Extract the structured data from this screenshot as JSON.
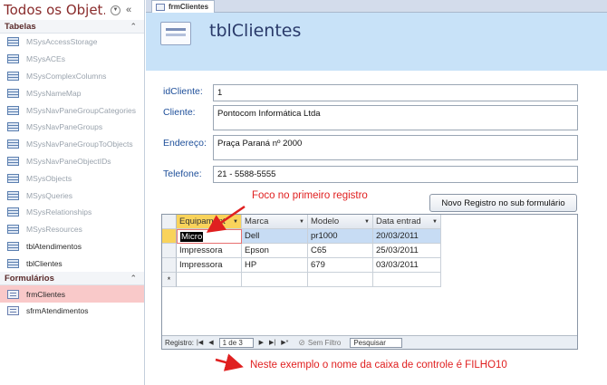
{
  "nav": {
    "title": "Todos os Objet...",
    "groups": [
      {
        "label": "Tabelas",
        "items": [
          {
            "label": "MSysAccessStorage",
            "icon": "table-icon",
            "dim": true
          },
          {
            "label": "MSysACEs",
            "icon": "table-icon",
            "dim": true
          },
          {
            "label": "MSysComplexColumns",
            "icon": "table-icon",
            "dim": true
          },
          {
            "label": "MSysNameMap",
            "icon": "table-icon",
            "dim": true
          },
          {
            "label": "MSysNavPaneGroupCategories",
            "icon": "table-icon",
            "dim": true
          },
          {
            "label": "MSysNavPaneGroups",
            "icon": "table-icon",
            "dim": true
          },
          {
            "label": "MSysNavPaneGroupToObjects",
            "icon": "table-icon",
            "dim": true
          },
          {
            "label": "MSysNavPaneObjectIDs",
            "icon": "table-icon",
            "dim": true
          },
          {
            "label": "MSysObjects",
            "icon": "table-icon",
            "dim": true
          },
          {
            "label": "MSysQueries",
            "icon": "table-icon",
            "dim": true
          },
          {
            "label": "MSysRelationships",
            "icon": "table-icon",
            "dim": true
          },
          {
            "label": "MSysResources",
            "icon": "table-icon",
            "dim": true
          },
          {
            "label": "tblAtendimentos",
            "icon": "table-icon",
            "dim": false
          },
          {
            "label": "tblClientes",
            "icon": "table-icon",
            "dim": false
          }
        ]
      },
      {
        "label": "Formulários",
        "items": [
          {
            "label": "frmClientes",
            "icon": "form-icon",
            "dim": false,
            "selected": true
          },
          {
            "label": "sfrmAtendimentos",
            "icon": "form-icon",
            "dim": false
          }
        ]
      }
    ]
  },
  "tab": {
    "label": "frmClientes"
  },
  "form": {
    "title": "tblClientes",
    "fields": {
      "id": {
        "label": "idCliente:",
        "value": "1"
      },
      "cliente": {
        "label": "Cliente:",
        "value": "Pontocom Informática Ltda"
      },
      "endereco": {
        "label": "Endereço:",
        "value": "Praça Paraná nº 2000"
      },
      "telefone": {
        "label": "Telefone:",
        "value": "21 - 5588-5555"
      }
    },
    "new_button": "Novo Registro no sub formulário"
  },
  "subform": {
    "columns": [
      "Equipament",
      "Marca",
      "Modelo",
      "Data entrad"
    ],
    "rows": [
      [
        "Micro",
        "Dell",
        "pr1000",
        "20/03/2011"
      ],
      [
        "Impressora",
        "Epson",
        "C65",
        "25/03/2011"
      ],
      [
        "Impressora",
        "HP",
        "679",
        "03/03/2011"
      ]
    ],
    "new_row_marker": "*",
    "recnav": {
      "label": "Registro:",
      "position": "1 de 3",
      "filter": "Sem Filtro",
      "search": "Pesquisar"
    }
  },
  "annotations": {
    "focus": "Foco no primeiro registro",
    "bottom": "Neste exemplo o nome da caixa de controle é FILHO10",
    "color": "#e02020"
  }
}
